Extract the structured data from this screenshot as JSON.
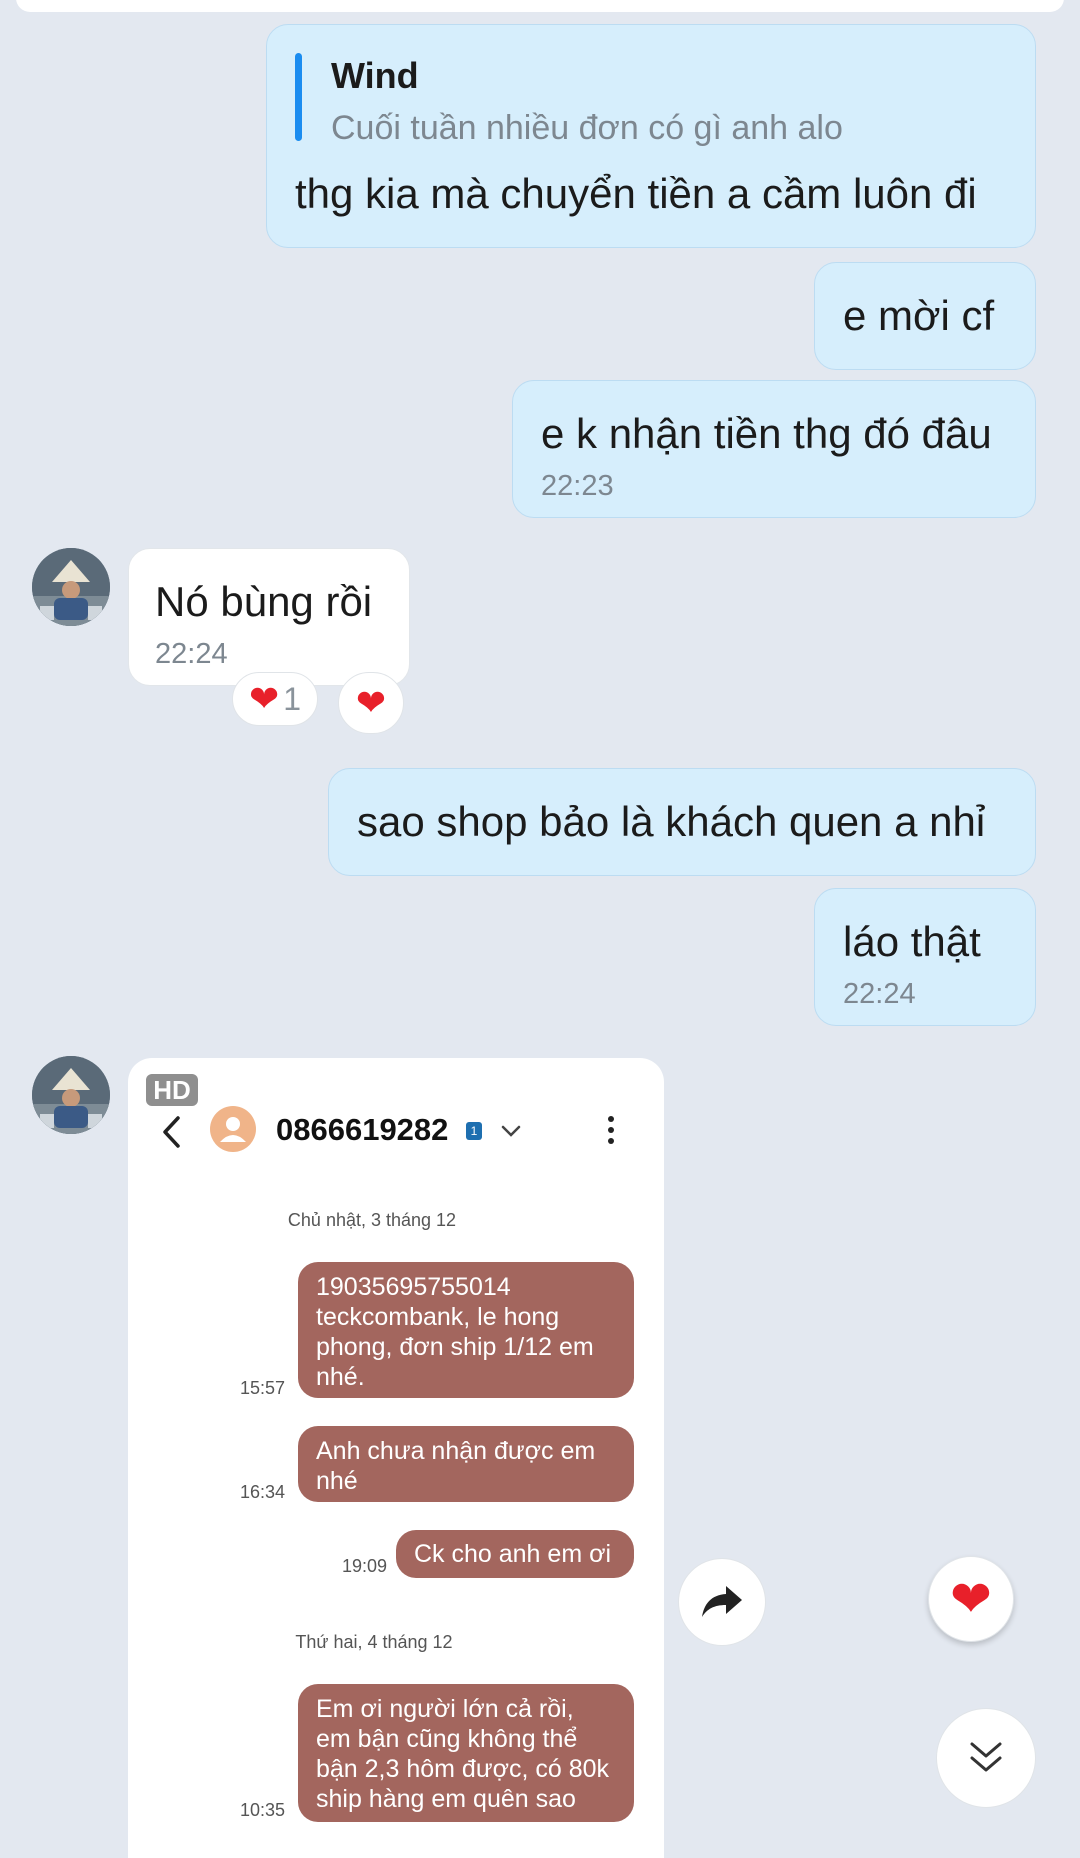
{
  "messages": {
    "quoted_reply": {
      "quote_name": "Wind",
      "quote_text": "Cuối tuần nhiều đơn có gì anh alo",
      "text": "thg kia mà chuyển tiền a cầm luôn đi"
    },
    "msg2": {
      "text": "e mời cf"
    },
    "msg3": {
      "text": "e k nhận tiền thg đó đâu",
      "time": "22:23"
    },
    "msg4": {
      "text": "Nó bùng rồi",
      "time": "22:24",
      "reaction_count": "1"
    },
    "msg5": {
      "text": "sao shop bảo là khách quen a nhỉ"
    },
    "msg6": {
      "text": "láo thật",
      "time": "22:24"
    }
  },
  "image_message": {
    "badge": "HD",
    "phone_number": "0866619282",
    "sim_badge": "1",
    "date1": "Chủ nhật, 3 tháng 12",
    "sms": [
      {
        "time": "15:57",
        "text": "19035695755014\nteckcombank, le hong\nphong, đơn ship 1/12 em\nnhé."
      },
      {
        "time": "16:34",
        "text": "Anh chưa nhận được em\nnhé"
      },
      {
        "time": "19:09",
        "text": "Ck cho anh em ơi"
      },
      {
        "time": "10:35",
        "text": " Em ơi người lớn cả rồi,\nem bận cũng không thể\nbận 2,3 hôm được, có 80k\nship hàng em quên sao"
      }
    ],
    "date2": "Thứ hai, 4 tháng 12"
  },
  "colors": {
    "background": "#e3e8f0",
    "outgoing_bubble": "#d6eefc",
    "incoming_bubble": "#ffffff",
    "quote_bar": "#1a8cf0",
    "sms_bubble": "#a3665e",
    "heart": "#e8202a"
  },
  "icons": [
    "heart-icon",
    "forward-icon",
    "scroll-down-icon",
    "back-arrow-icon",
    "contact-icon",
    "more-vert-icon",
    "chevron-down-icon"
  ]
}
